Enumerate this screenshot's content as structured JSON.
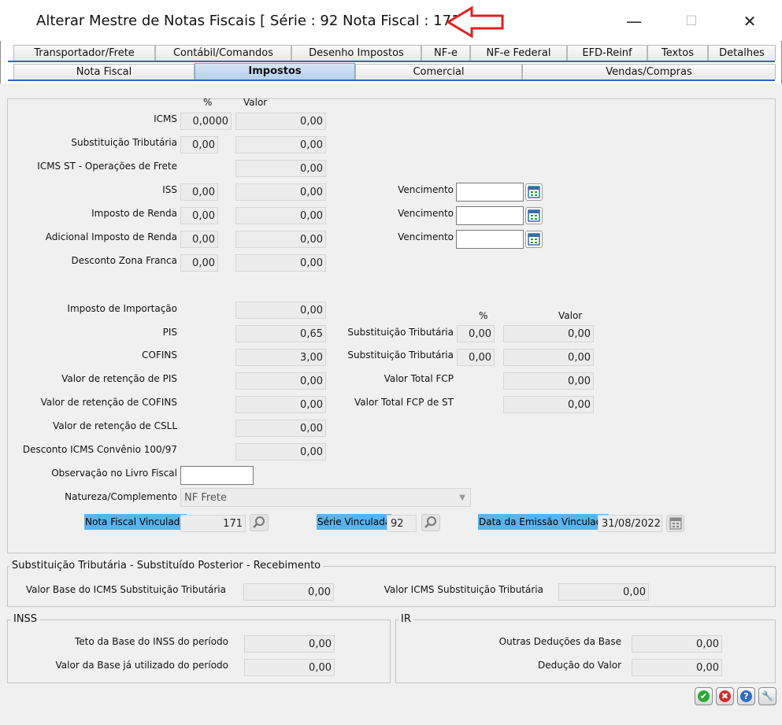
{
  "window": {
    "title": "Alterar Mestre de Notas Fiscais [ Série : 92  Nota Fiscal : 171 ]",
    "minimize": "—",
    "maximize": "☐",
    "close": "✕"
  },
  "tabs_row1": [
    "Transportador/Frete",
    "Contábil/Comandos",
    "Desenho Impostos",
    "NF-e",
    "NF-e Federal",
    "EFD-Reinf",
    "Textos",
    "Detalhes"
  ],
  "tabs_row2": [
    "Nota Fiscal",
    "Impostos",
    "Comercial",
    "Vendas/Compras"
  ],
  "selected_tab": "Impostos",
  "headers": {
    "pct": "%",
    "valor": "Valor",
    "pct2": "%",
    "valor2": "Valor"
  },
  "left": {
    "icms": {
      "label": "ICMS",
      "pct": "0,0000",
      "valor": "0,00"
    },
    "subst": {
      "label": "Substituição Tributária",
      "pct": "0,00",
      "valor": "0,00"
    },
    "icms_st_frete": {
      "label": "ICMS ST - Operações de Frete",
      "valor": "0,00"
    },
    "iss": {
      "label": "ISS",
      "pct": "0,00",
      "valor": "0,00",
      "venc_label": "Vencimento",
      "venc": ""
    },
    "ir": {
      "label": "Imposto de Renda",
      "pct": "0,00",
      "valor": "0,00",
      "venc_label": "Vencimento",
      "venc": ""
    },
    "adic_ir": {
      "label": "Adicional Imposto de Renda",
      "pct": "0,00",
      "valor": "0,00",
      "venc_label": "Vencimento",
      "venc": ""
    },
    "zona_franca": {
      "label": "Desconto Zona Franca",
      "pct": "0,00",
      "valor": "0,00"
    },
    "importacao": {
      "label": "Imposto de Importação",
      "valor": "0,00"
    },
    "pis": {
      "label": "PIS",
      "valor": "0,65"
    },
    "cofins": {
      "label": "COFINS",
      "valor": "3,00"
    },
    "ret_pis": {
      "label": "Valor de retenção de PIS",
      "valor": "0,00"
    },
    "ret_cofins": {
      "label": "Valor de retenção de COFINS",
      "valor": "0,00"
    },
    "ret_csll": {
      "label": "Valor de retenção de CSLL",
      "valor": "0,00"
    },
    "desc_icms": {
      "label": "Desconto ICMS Convênio 100/97",
      "valor": "0,00"
    },
    "obs_livro": {
      "label": "Observação no Livro Fiscal",
      "value": ""
    },
    "natureza": {
      "label": "Natureza/Complemento",
      "value": "NF Frete"
    }
  },
  "right": {
    "st_pis": {
      "label": "Substituição Tributária",
      "pct": "0,00",
      "valor": "0,00"
    },
    "st_cofins": {
      "label": "Substituição Tributária",
      "pct": "0,00",
      "valor": "0,00"
    },
    "fcp": {
      "label": "Valor Total FCP",
      "valor": "0,00"
    },
    "fcp_st": {
      "label": "Valor Total FCP de ST",
      "valor": "0,00"
    }
  },
  "vinculada": {
    "nf_label": "Nota Fiscal Vinculada",
    "nf_value": "171",
    "serie_label": "Série Vinculada",
    "serie_value": "92",
    "data_label": "Data da Emissão Vinculada",
    "data_value": "31/08/2022"
  },
  "st_group": {
    "title": "Substituição Tributária - Substituído Posterior - Recebimento",
    "base_label": "Valor Base do ICMS Substituição Tributária",
    "base_value": "0,00",
    "icms_label": "Valor ICMS Substituição Tributária",
    "icms_value": "0,00"
  },
  "inss_group": {
    "title": "INSS",
    "teto_label": "Teto da Base do INSS do período",
    "teto_value": "0,00",
    "usado_label": "Valor da Base já utilizado do período",
    "usado_value": "0,00"
  },
  "ir_group": {
    "title": "IR",
    "outras_label": "Outras Deduções da Base",
    "outras_value": "0,00",
    "deducao_label": "Dedução do Valor",
    "deducao_value": "0,00"
  },
  "buttons": {
    "ok": "✔",
    "cancel": "✖",
    "help": "?",
    "tools": "🔧"
  },
  "colors": {
    "highlight": "#58b4f0",
    "tab_selected": "#b3cee8",
    "arrow": "#e02020"
  }
}
